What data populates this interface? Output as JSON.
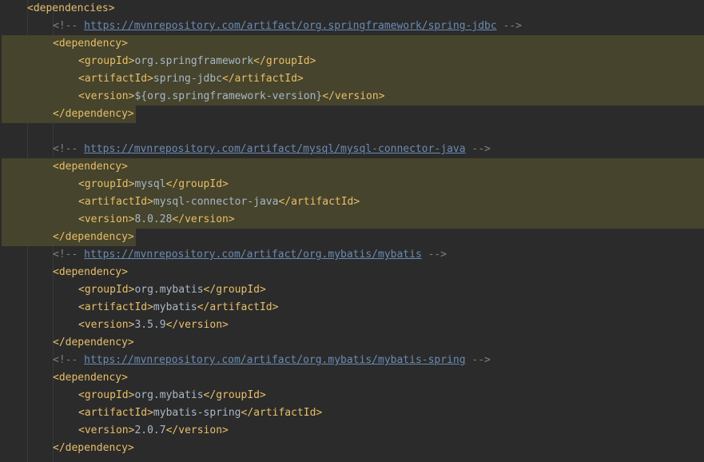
{
  "editor": {
    "colors": {
      "background": "#2b2b2b",
      "tag": "#e8bf6a",
      "text": "#a9b7c6",
      "comment": "#808080",
      "link": "#6a8bb3",
      "highlight": "#46442c"
    },
    "lines": [
      {
        "indent": 0,
        "type": "tag",
        "text": "<dependencies>"
      },
      {
        "indent": 1,
        "type": "comment",
        "prefix": "<!-- ",
        "url": "https://mvnrepository.com/artifact/org.springframework/spring-jdbc",
        "suffix": " -->"
      },
      {
        "indent": 1,
        "type": "tag",
        "text": "<dependency>",
        "highlight": "block"
      },
      {
        "indent": 2,
        "type": "element",
        "open": "<groupId>",
        "value": "org.springframework",
        "close": "</groupId>",
        "highlight": "block"
      },
      {
        "indent": 2,
        "type": "element",
        "open": "<artifactId>",
        "value": "spring-jdbc",
        "close": "</artifactId>",
        "highlight": "block"
      },
      {
        "indent": 2,
        "type": "element",
        "open": "<version>",
        "value": "${org.springframework-version}",
        "close": "</version>",
        "highlight": "block"
      },
      {
        "indent": 1,
        "type": "tag",
        "text": "</dependency>",
        "highlight": "end"
      },
      {
        "indent": 0,
        "type": "blank",
        "text": ""
      },
      {
        "indent": 1,
        "type": "comment",
        "prefix": "<!-- ",
        "url": "https://mvnrepository.com/artifact/mysql/mysql-connector-java",
        "suffix": " -->"
      },
      {
        "indent": 1,
        "type": "tag",
        "text": "<dependency>",
        "highlight": "block"
      },
      {
        "indent": 2,
        "type": "element",
        "open": "<groupId>",
        "value": "mysql",
        "close": "</groupId>",
        "highlight": "block"
      },
      {
        "indent": 2,
        "type": "element",
        "open": "<artifactId>",
        "value": "mysql-connector-java",
        "close": "</artifactId>",
        "highlight": "block"
      },
      {
        "indent": 2,
        "type": "element",
        "open": "<version>",
        "value": "8.0.28",
        "close": "</version>",
        "highlight": "block"
      },
      {
        "indent": 1,
        "type": "tag",
        "text": "</dependency>",
        "highlight": "end"
      },
      {
        "indent": 1,
        "type": "comment",
        "prefix": "<!-- ",
        "url": "https://mvnrepository.com/artifact/org.mybatis/mybatis",
        "suffix": " -->"
      },
      {
        "indent": 1,
        "type": "tag",
        "text": "<dependency>"
      },
      {
        "indent": 2,
        "type": "element",
        "open": "<groupId>",
        "value": "org.mybatis",
        "close": "</groupId>"
      },
      {
        "indent": 2,
        "type": "element",
        "open": "<artifactId>",
        "value": "mybatis",
        "close": "</artifactId>"
      },
      {
        "indent": 2,
        "type": "element",
        "open": "<version>",
        "value": "3.5.9",
        "close": "</version>"
      },
      {
        "indent": 1,
        "type": "tag",
        "text": "</dependency>"
      },
      {
        "indent": 1,
        "type": "comment",
        "prefix": "<!-- ",
        "url": "https://mvnrepository.com/artifact/org.mybatis/mybatis-spring",
        "suffix": " -->"
      },
      {
        "indent": 1,
        "type": "tag",
        "text": "<dependency>"
      },
      {
        "indent": 2,
        "type": "element",
        "open": "<groupId>",
        "value": "org.mybatis",
        "close": "</groupId>"
      },
      {
        "indent": 2,
        "type": "element",
        "open": "<artifactId>",
        "value": "mybatis-spring",
        "close": "</artifactId>"
      },
      {
        "indent": 2,
        "type": "element",
        "open": "<version>",
        "value": "2.0.7",
        "close": "</version>"
      },
      {
        "indent": 1,
        "type": "tag",
        "text": "</dependency>"
      }
    ]
  }
}
